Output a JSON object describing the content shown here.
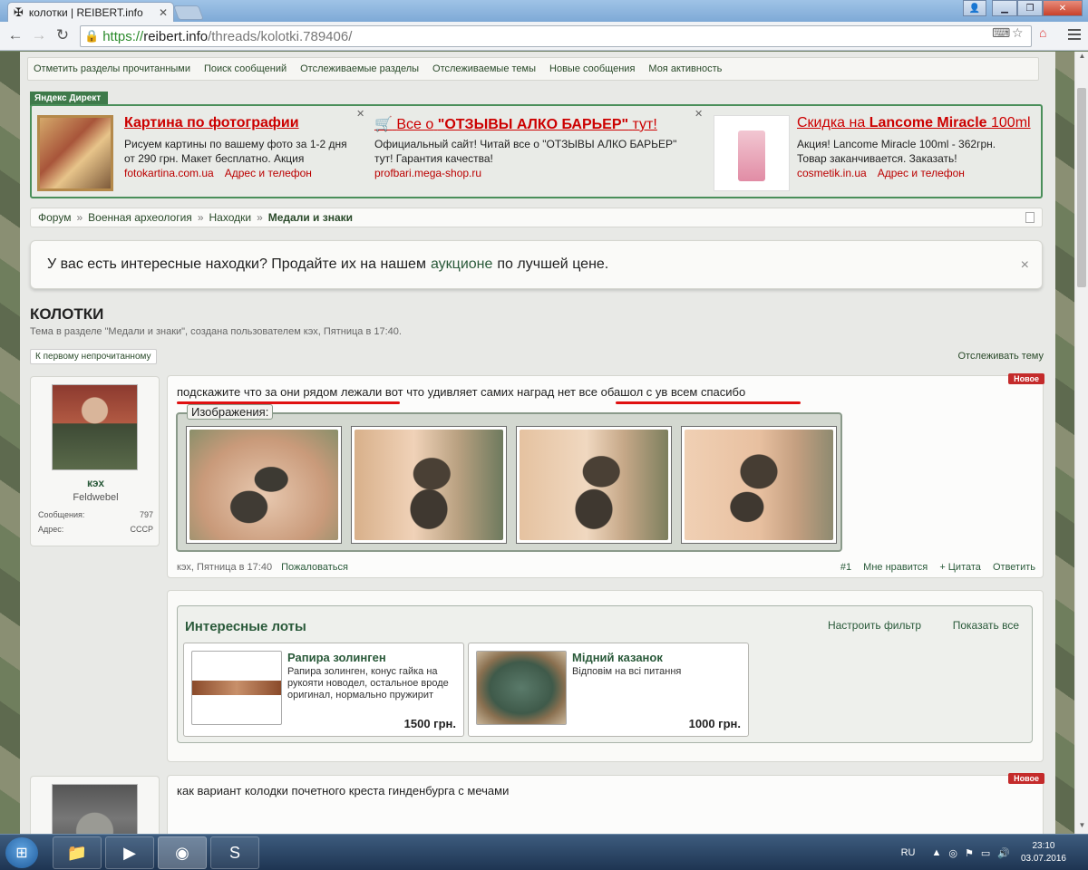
{
  "browser": {
    "tab_title": "колотки | REIBERT.info",
    "tab_icon": "iron-cross-icon",
    "url_scheme": "https://",
    "url_host": "reibert.info",
    "url_path": "/threads/kolotki.789406/"
  },
  "navstrip": {
    "items": [
      "Отметить разделы прочитанными",
      "Поиск сообщений",
      "Отслеживаемые разделы",
      "Отслеживаемые темы",
      "Новые сообщения",
      "Моя активность"
    ]
  },
  "direct": {
    "label": "Яндекс Директ",
    "ads": [
      {
        "title": "Картина по фотографии",
        "desc_line1": "Рисуем картины по вашему фото за 1-2 дня",
        "desc_line2": "от 290 грн. Макет бесплатно. Акция",
        "domain": "fotokartina.com.ua",
        "contacts": "Адрес и телефон"
      },
      {
        "title_prefix": "Все о",
        "title_bold": "\"ОТЗЫВЫ АЛКО БАРЬЕР\"",
        "title_suffix": "тут!",
        "desc_line1": "Официальный сайт! Читай все о \"ОТЗЫВЫ АЛКО БАРЬЕР\"",
        "desc_line2": "тут! Гарантия качества!",
        "domain": "profbari.mega-shop.ru"
      },
      {
        "title_prefix": "Скидка на",
        "title_bold": "Lancome Miracle",
        "title_suffix": "100ml",
        "desc_line1": "Акция! Lancome Miracle 100ml - 362грн.",
        "desc_line2": "Товар заканчивается. Заказать!",
        "domain": "cosmetik.in.ua",
        "contacts": "Адрес и телефон"
      }
    ]
  },
  "breadcrumb": {
    "items": [
      "Форум",
      "Военная археология",
      "Находки"
    ],
    "current": "Медали и знаки",
    "separator": "»"
  },
  "notice": {
    "text_before": "У вас есть интересные находки? Продайте их на нашем",
    "link": "аукционе",
    "text_after": "по лучшей цене.",
    "close": "×"
  },
  "thread": {
    "title": "КОЛОТКИ",
    "description": "Тема в разделе \"Медали и знаки\", создана пользователем кэх, Пятница в 17:40.",
    "first_unread": "К первому непрочитанному",
    "watch": "Отслеживать тему"
  },
  "post1": {
    "user": {
      "name": "кэх",
      "title": "Feldwebel",
      "messages_label": "Сообщения:",
      "messages_value": "797",
      "address_label": "Адрес:",
      "address_value": "СССР"
    },
    "badge": "Новое",
    "text": "подскажите что за они рядом лежали вот что удивляет самих наград нет все обашол с ув всем спасибо",
    "attachments_label": "Изображения:",
    "footer_author": "кэх, Пятница в 17:40",
    "footer_report": "Пожаловаться",
    "number": "#1",
    "like": "Мне нравится",
    "quote": "+ Цитата",
    "reply": "Ответить"
  },
  "lots": {
    "title": "Интересные лоты",
    "filter": "Настроить фильтр",
    "show_all": "Показать все",
    "items": [
      {
        "title": "Рапира золинген",
        "desc": "Рапира золинген, конус гайка на рукояти новодел, остальное вроде оригинал, нормально пружирит",
        "price": "1500 грн."
      },
      {
        "title": "Мідний казанок",
        "desc": "Відповім на всі питання",
        "price": "1000 грн."
      }
    ]
  },
  "post2": {
    "badge": "Новое",
    "text": "как вариант колодки почетного креста гинденбурга с мечами"
  },
  "taskbar": {
    "lang": "RU",
    "time": "23:10",
    "date": "03.07.2016"
  },
  "colors": {
    "accent_green": "#2a5a3a",
    "ad_red": "#cc0000",
    "badge_red": "#c42b2b"
  }
}
